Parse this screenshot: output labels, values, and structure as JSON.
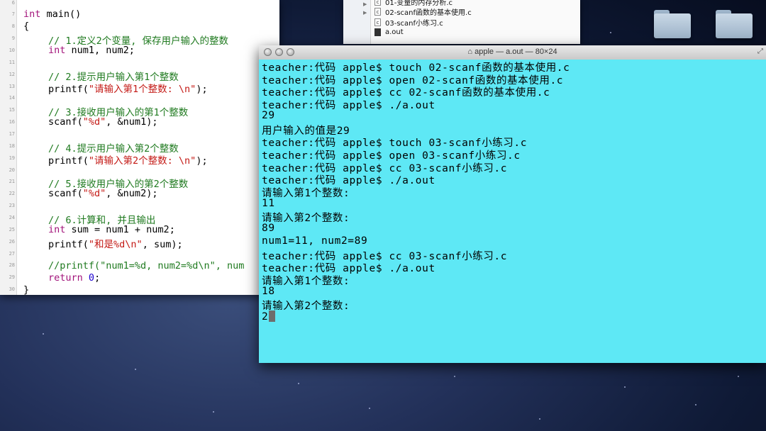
{
  "editor": {
    "line_numbers": [
      "6",
      "7",
      "8",
      "9",
      "10",
      "11",
      "12",
      "13",
      "14",
      "15",
      "16",
      "17",
      "18",
      "19",
      "20",
      "21",
      "22",
      "23",
      "24",
      "25",
      "26",
      "27",
      "28",
      "29",
      "30"
    ],
    "code": {
      "l7": "int main()",
      "l8": "{",
      "l9": "// 1.定义2个变量, 保存用户输入的整数",
      "l10_kw": "int",
      "l10_rest": " num1, num2;",
      "l12": "// 2.提示用户输入第1个整数",
      "l13_fn": "printf(",
      "l13_str": "\"请输入第1个整数: \\n\"",
      "l13_end": ");",
      "l15": "// 3.接收用户输入的第1个整数",
      "l16_fn": "scanf(",
      "l16_str": "\"%d\"",
      "l16_end": ", &num1);",
      "l18": "// 4.提示用户输入第2个整数",
      "l19_fn": "printf(",
      "l19_str": "\"请输入第2个整数: \\n\"",
      "l19_end": ");",
      "l21": "// 5.接收用户输入的第2个整数",
      "l22_fn": "scanf(",
      "l22_str": "\"%d\"",
      "l22_end": ", &num2);",
      "l24": "// 6.计算和, 并且输出",
      "l25_kw": "int",
      "l25_rest": " sum = num1 + num2;",
      "l26_fn": "printf(",
      "l26_str": "\"和是%d\\n\"",
      "l26_end": ", sum);",
      "l28": "//printf(\"num1=%d, num2=%d\\n\", num",
      "l29_kw": "return",
      "l29_num": "0",
      "l29_end": ";",
      "l30": "}"
    }
  },
  "finder": {
    "files": [
      {
        "name": "01-变量的内存分析.c",
        "icon": "c"
      },
      {
        "name": "02-scanf函数的基本使用.c",
        "icon": "c"
      },
      {
        "name": "03-scanf小练习.c",
        "icon": "c"
      },
      {
        "name": "a.out",
        "icon": "exec"
      }
    ]
  },
  "terminal": {
    "title": "apple — a.out — 80×24",
    "lines": [
      "teacher:代码 apple$ touch 02-scanf函数的基本使用.c",
      "teacher:代码 apple$ open 02-scanf函数的基本使用.c",
      "teacher:代码 apple$ cc 02-scanf函数的基本使用.c",
      "teacher:代码 apple$ ./a.out",
      "29",
      "用户输入的值是29",
      "teacher:代码 apple$ touch 03-scanf小练习.c",
      "teacher:代码 apple$ open 03-scanf小练习.c",
      "teacher:代码 apple$ cc 03-scanf小练习.c",
      "teacher:代码 apple$ ./a.out",
      "请输入第1个整数:",
      "11",
      "请输入第2个整数:",
      "89",
      "num1=11, num2=89",
      "teacher:代码 apple$ cc 03-scanf小练习.c",
      "teacher:代码 apple$ ./a.out",
      "请输入第1个整数:",
      "18",
      "请输入第2个整数:"
    ],
    "input_line": "2",
    "bg_color": "#5ee8f5"
  }
}
